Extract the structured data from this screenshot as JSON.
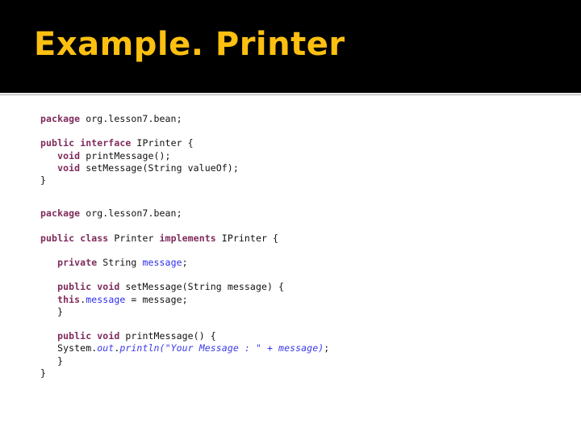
{
  "slide": {
    "title": "Example. Printer",
    "title_color": "#fdc010",
    "header_color": "#000000",
    "background_color": "#ffffff"
  },
  "code_blocks": [
    {
      "name": "iprinter-interface",
      "lines": [
        [
          {
            "t": "package",
            "c": "kw"
          },
          {
            "t": " org.lesson7.bean;",
            "c": "plain"
          }
        ],
        [
          {
            "t": "",
            "c": "plain"
          }
        ],
        [
          {
            "t": "public",
            "c": "kw"
          },
          {
            "t": " ",
            "c": "plain"
          },
          {
            "t": "interface",
            "c": "kw"
          },
          {
            "t": " IPrinter {",
            "c": "plain"
          }
        ],
        [
          {
            "t": "   ",
            "c": "plain"
          },
          {
            "t": "void",
            "c": "kw"
          },
          {
            "t": " printMessage();",
            "c": "plain"
          }
        ],
        [
          {
            "t": "   ",
            "c": "plain"
          },
          {
            "t": "void",
            "c": "kw"
          },
          {
            "t": " setMessage(String valueOf);",
            "c": "plain"
          }
        ],
        [
          {
            "t": "}",
            "c": "plain"
          }
        ]
      ]
    },
    {
      "name": "printer-class",
      "lines": [
        [
          {
            "t": "package",
            "c": "kw"
          },
          {
            "t": " org.lesson7.bean;",
            "c": "plain"
          }
        ],
        [
          {
            "t": "",
            "c": "plain"
          }
        ],
        [
          {
            "t": "public",
            "c": "kw"
          },
          {
            "t": " ",
            "c": "plain"
          },
          {
            "t": "class",
            "c": "kw"
          },
          {
            "t": " Printer ",
            "c": "plain"
          },
          {
            "t": "implements",
            "c": "kw"
          },
          {
            "t": " IPrinter {",
            "c": "plain"
          }
        ],
        [
          {
            "t": "",
            "c": "plain"
          }
        ],
        [
          {
            "t": "   ",
            "c": "plain"
          },
          {
            "t": "private",
            "c": "kw"
          },
          {
            "t": " String ",
            "c": "plain"
          },
          {
            "t": "message",
            "c": "field"
          },
          {
            "t": ";",
            "c": "plain"
          }
        ],
        [
          {
            "t": "",
            "c": "plain"
          }
        ],
        [
          {
            "t": "   ",
            "c": "plain"
          },
          {
            "t": "public",
            "c": "kw"
          },
          {
            "t": " ",
            "c": "plain"
          },
          {
            "t": "void",
            "c": "kw"
          },
          {
            "t": " setMessage(String message) {",
            "c": "plain"
          }
        ],
        [
          {
            "t": "   ",
            "c": "plain"
          },
          {
            "t": "this",
            "c": "kw"
          },
          {
            "t": ".",
            "c": "plain"
          },
          {
            "t": "message",
            "c": "field"
          },
          {
            "t": " = message;",
            "c": "plain"
          }
        ],
        [
          {
            "t": "   }",
            "c": "plain"
          }
        ],
        [
          {
            "t": "",
            "c": "plain"
          }
        ],
        [
          {
            "t": "   ",
            "c": "plain"
          },
          {
            "t": "public",
            "c": "kw"
          },
          {
            "t": " ",
            "c": "plain"
          },
          {
            "t": "void",
            "c": "kw"
          },
          {
            "t": " printMessage() {",
            "c": "plain"
          }
        ],
        [
          {
            "t": "   System.",
            "c": "plain"
          },
          {
            "t": "out",
            "c": "static"
          },
          {
            "t": ".",
            "c": "plain"
          },
          {
            "t": "println(",
            "c": "str"
          },
          {
            "t": "\"Your Message : \"",
            "c": "str"
          },
          {
            "t": " + ",
            "c": "str"
          },
          {
            "t": "message)",
            "c": "str"
          },
          {
            "t": ";",
            "c": "plain"
          }
        ],
        [
          {
            "t": "   }",
            "c": "plain"
          }
        ],
        [
          {
            "t": "}",
            "c": "plain"
          }
        ]
      ]
    }
  ]
}
